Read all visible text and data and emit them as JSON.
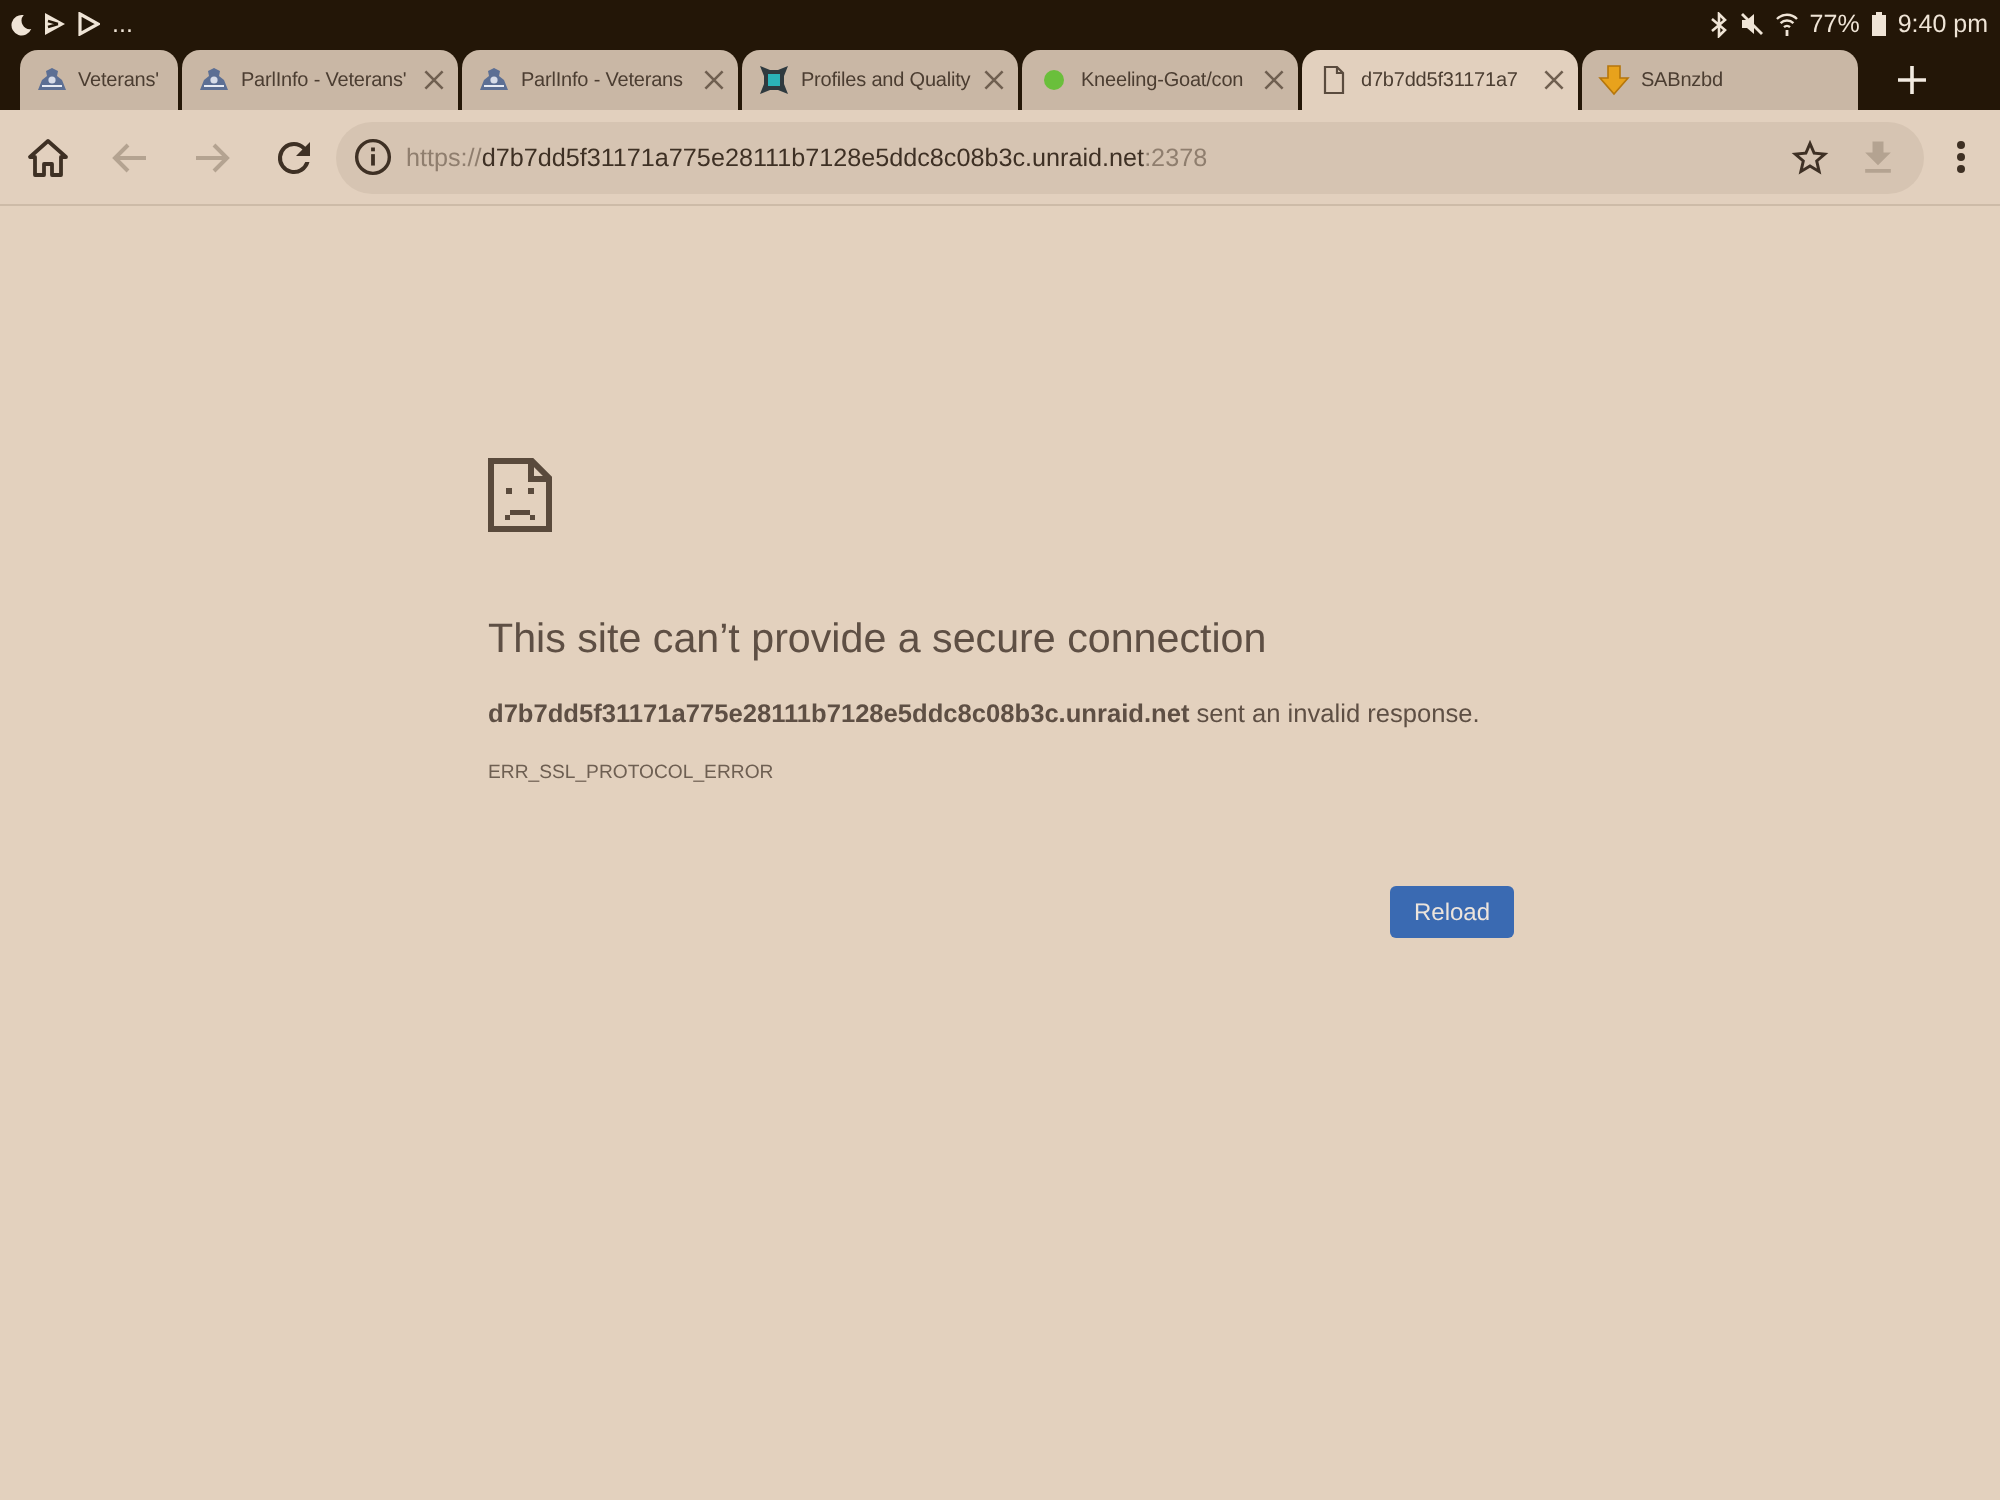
{
  "status_bar": {
    "overflow": "...",
    "battery": "77%",
    "time": "9:40 pm"
  },
  "tabs": [
    {
      "kind": "crest",
      "title": "Veterans'",
      "selected": false,
      "closable": false
    },
    {
      "kind": "crest",
      "title": "ParlInfo - Veterans'",
      "selected": false,
      "closable": true
    },
    {
      "kind": "crest",
      "title": "ParlInfo - Veterans",
      "selected": false,
      "closable": true
    },
    {
      "kind": "app",
      "title": "Profiles and Quality",
      "selected": false,
      "closable": true
    },
    {
      "kind": "dot",
      "title": "Kneeling-Goat/con",
      "selected": false,
      "closable": true
    },
    {
      "kind": "page",
      "title": "d7b7dd5f31171a7",
      "selected": true,
      "closable": true
    },
    {
      "kind": "arrow",
      "title": "SABnzbd",
      "selected": false,
      "closable": false
    }
  ],
  "toolbar": {
    "nav": [
      {
        "kind": "home",
        "disabled": false
      },
      {
        "kind": "back",
        "disabled": true
      },
      {
        "kind": "forward",
        "disabled": true
      },
      {
        "kind": "reload",
        "disabled": false
      }
    ],
    "address_bar": {
      "scheme": "https://",
      "host": "d7b7dd5f31171a775e28111b7128e5ddc8c08b3c.unraid.net",
      "port": ":2378",
      "actions": [
        {
          "kind": "star",
          "disabled": false
        },
        {
          "kind": "download",
          "disabled": true
        }
      ]
    }
  },
  "error_page": {
    "title": "This site can’t provide a secure connection",
    "message": "**d7b7dd5f31171a775e28111b7128e5ddc8c08b3c.unraid.net** sent an invalid response.",
    "code": "ERR_SSL_PROTOCOL_ERROR",
    "button": "Reload"
  }
}
